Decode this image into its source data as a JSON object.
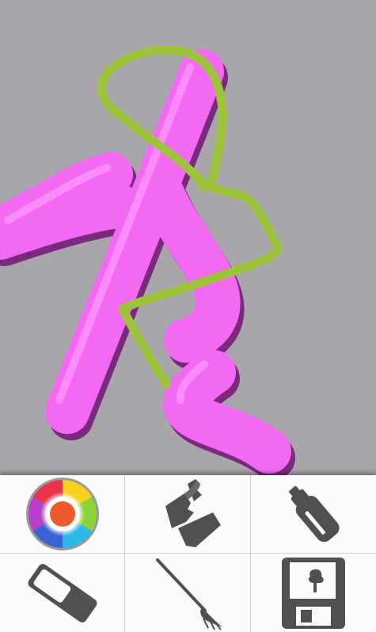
{
  "canvas": {
    "background_color": "#a9a6ab",
    "strokes": [
      {
        "tool": "brush",
        "color": "#f469f4",
        "shadow_color": "#7a2a7c"
      },
      {
        "tool": "brush",
        "color": "#9dc43a"
      }
    ]
  },
  "toolbar": {
    "buttons": [
      {
        "id": "color",
        "icon": "color-wheel-icon",
        "label": ""
      },
      {
        "id": "smudge",
        "icon": "smudge-icon",
        "label": ""
      },
      {
        "id": "spray",
        "icon": "spray-can-icon",
        "label": ""
      },
      {
        "id": "eraser",
        "icon": "eraser-icon",
        "label": ""
      },
      {
        "id": "brush",
        "icon": "paintbrush-icon",
        "label": ""
      },
      {
        "id": "save",
        "icon": "save-icon",
        "label": ""
      }
    ],
    "current_color": "#ee5a2e",
    "icon_color": "#505052"
  }
}
